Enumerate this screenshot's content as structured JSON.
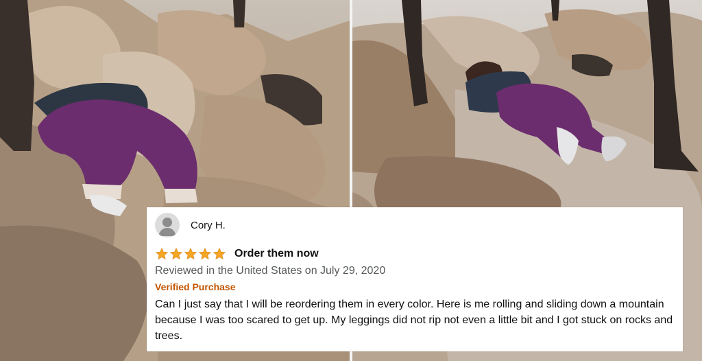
{
  "review": {
    "reviewer_name": "Cory H.",
    "rating": 5,
    "rating_max": 5,
    "title": "Order them now",
    "meta": "Reviewed in the United States on July 29, 2020",
    "verified": "Verified Purchase",
    "body": "Can I just say that I will be reordering them in every color. Here is me rolling and sliding down a mountain because I was too scared to get up. My leggings did not rip not even a little bit and I got stuck on rocks and trees."
  },
  "colors": {
    "star": "#f5a623",
    "verified": "#c45500",
    "meta": "#565959",
    "leggings": "#6b2d6e"
  },
  "icons": {
    "avatar": "person-silhouette-icon",
    "star": "star-icon"
  }
}
